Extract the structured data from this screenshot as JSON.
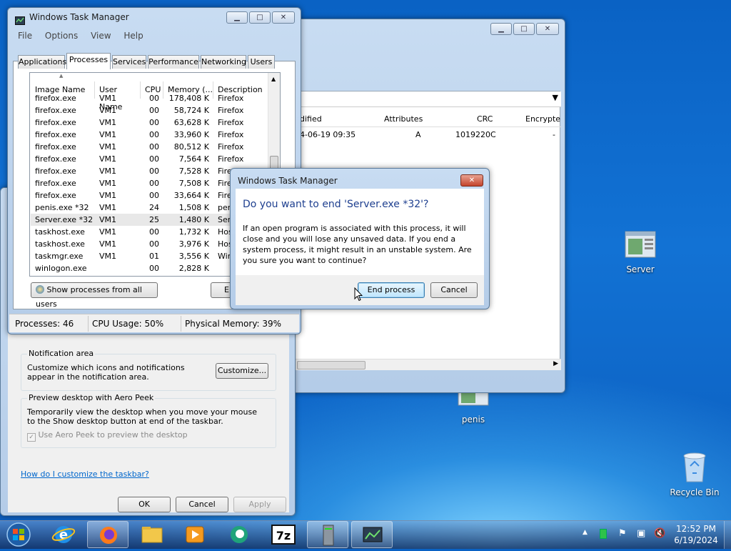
{
  "task_manager": {
    "title": "Windows Task Manager",
    "menu": [
      "File",
      "Options",
      "View",
      "Help"
    ],
    "tabs": [
      "Applications",
      "Processes",
      "Services",
      "Performance",
      "Networking",
      "Users"
    ],
    "active_tab": "Processes",
    "columns": [
      "Image Name",
      "User Name",
      "CPU",
      "Memory (...",
      "Description"
    ],
    "rows": [
      [
        "firefox.exe",
        "VM1",
        "00",
        "178,408 K",
        "Firefox"
      ],
      [
        "firefox.exe",
        "VM1",
        "00",
        "58,724 K",
        "Firefox"
      ],
      [
        "firefox.exe",
        "VM1",
        "00",
        "63,628 K",
        "Firefox"
      ],
      [
        "firefox.exe",
        "VM1",
        "00",
        "33,960 K",
        "Firefox"
      ],
      [
        "firefox.exe",
        "VM1",
        "00",
        "80,512 K",
        "Firefox"
      ],
      [
        "firefox.exe",
        "VM1",
        "00",
        "7,564 K",
        "Firefox"
      ],
      [
        "firefox.exe",
        "VM1",
        "00",
        "7,528 K",
        "Fire"
      ],
      [
        "firefox.exe",
        "VM1",
        "00",
        "7,508 K",
        "Fire"
      ],
      [
        "firefox.exe",
        "VM1",
        "00",
        "33,664 K",
        "Fire"
      ],
      [
        "penis.exe *32",
        "VM1",
        "24",
        "1,508 K",
        "pen"
      ],
      [
        "Server.exe *32",
        "VM1",
        "25",
        "1,480 K",
        "Ser"
      ],
      [
        "taskhost.exe",
        "VM1",
        "00",
        "1,732 K",
        "Hos"
      ],
      [
        "taskhost.exe",
        "VM1",
        "00",
        "3,976 K",
        "Hos"
      ],
      [
        "taskmgr.exe",
        "VM1",
        "01",
        "3,556 K",
        "Win"
      ],
      [
        "winlogon.exe",
        "",
        "00",
        "2,828 K",
        ""
      ]
    ],
    "selected_row": 10,
    "show_all_label": "Show processes from all users",
    "end_label": "E",
    "status": {
      "processes": "Processes: 46",
      "cpu": "CPU Usage: 50%",
      "memory": "Physical Memory: 39%"
    }
  },
  "dialog": {
    "title": "Windows Task Manager",
    "question": "Do you want to end 'Server.exe *32'?",
    "message": "If an open program is associated with this process, it will close and you will lose any unsaved data. If you end a system process, it might result in an unstable system. Are you sure you want to continue?",
    "end_label": "End process",
    "cancel_label": "Cancel"
  },
  "archive_window": {
    "columns": [
      "dified",
      "Attributes",
      "CRC",
      "Encrypte"
    ],
    "row": [
      "4-06-19 09:35",
      "A",
      "1019220C",
      "-"
    ]
  },
  "taskbar_props": {
    "notif_title": "Notification area",
    "notif_text": "Customize which icons and notifications appear in the notification area.",
    "customize_label": "Customize...",
    "peek_title": "Preview desktop with Aero Peek",
    "peek_text": "Temporarily view the desktop when you move your mouse to the Show desktop button at end of the taskbar.",
    "peek_checkbox": "Use Aero Peek to preview the desktop",
    "help_link": "How do I customize the taskbar?",
    "ok": "OK",
    "cancel": "Cancel",
    "apply": "Apply"
  },
  "desktop_icons": {
    "server": "Server",
    "penis": "penis",
    "recycle": "Recycle Bin"
  },
  "clock": {
    "time": "12:52 PM",
    "date": "6/19/2024"
  },
  "taskbar_apps": [
    "start-orb",
    "internet-explorer-icon",
    "firefox-icon",
    "file-explorer-icon",
    "media-player-icon",
    "chat-app-icon",
    "7zip-icon",
    "server-manager-icon",
    "task-manager-icon"
  ],
  "colors": {
    "dialog_heading": "#1e3f8f",
    "link": "#0066cc",
    "taskbar": "#1c3a66"
  }
}
